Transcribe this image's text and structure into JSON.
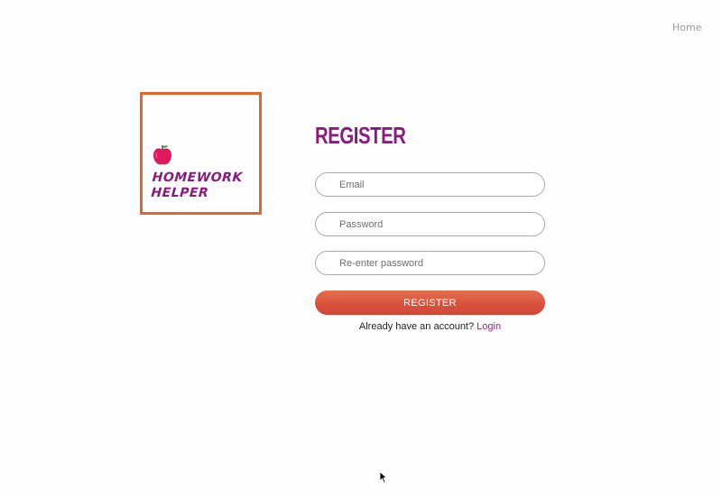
{
  "nav": {
    "home_label": "Home"
  },
  "logo": {
    "line1": "HOMEWORK",
    "line2": "HELPER",
    "icon": "apple-icon",
    "border_color": "#e0672e",
    "text_color": "#8b1a7e",
    "apple_color": "#e0195f"
  },
  "form": {
    "title": "REGISTER",
    "email_placeholder": "Email",
    "password_placeholder": "Password",
    "repassword_placeholder": "Re-enter password",
    "submit_label": "REGISTER",
    "have_account_text": "Already have an account?",
    "login_label": "Login"
  },
  "colors": {
    "accent": "#8b1a7e",
    "button_gradient_top": "#e2704c",
    "button_gradient_bottom": "#d04738",
    "link": "#b8178a"
  }
}
